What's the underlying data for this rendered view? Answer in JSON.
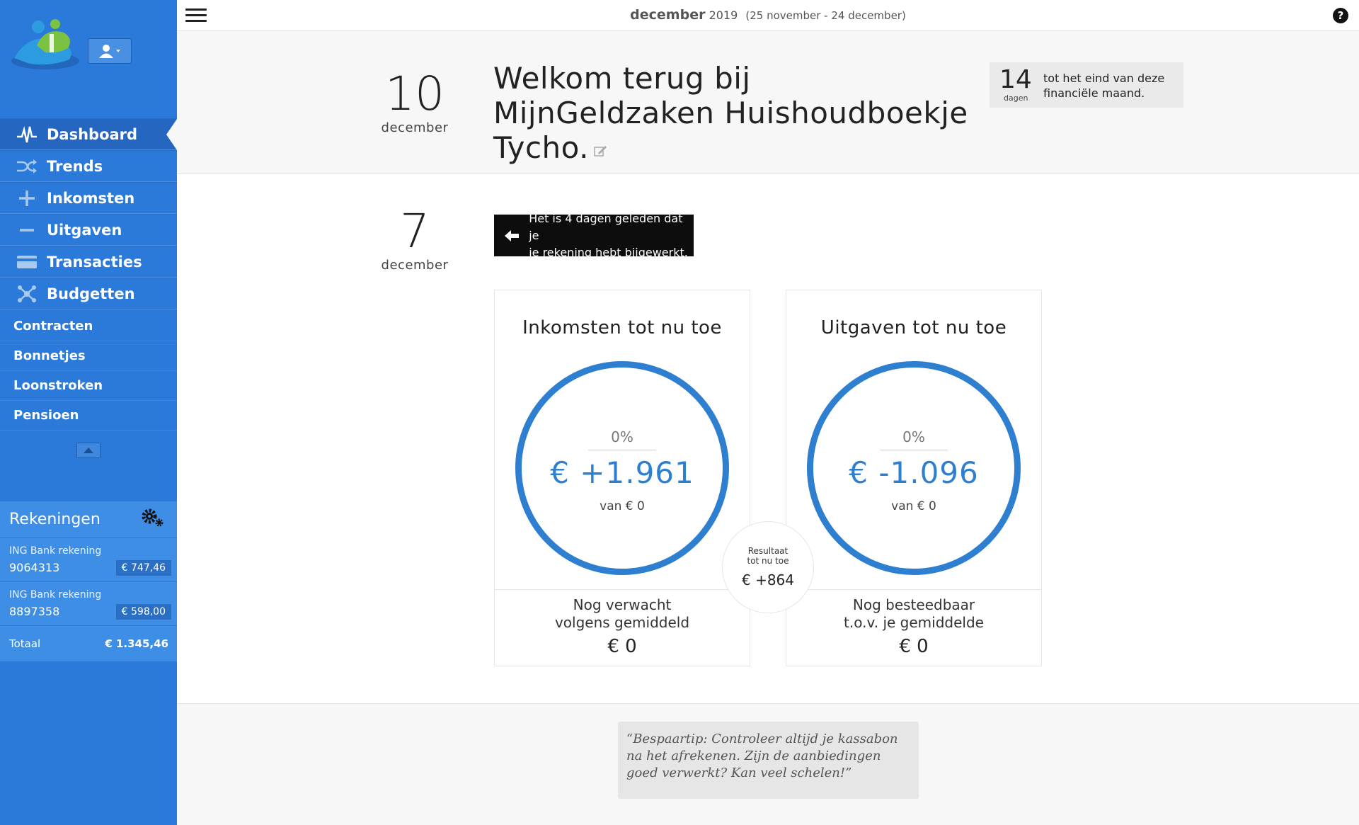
{
  "topbar": {
    "month": "december",
    "year": "2019",
    "range": "(25 november - 24 december)"
  },
  "sidebar": {
    "nav_primary": [
      {
        "label": "Dashboard",
        "icon": "pulse-icon"
      },
      {
        "label": "Trends",
        "icon": "shuffle-icon"
      },
      {
        "label": "Inkomsten",
        "icon": "plus-icon"
      },
      {
        "label": "Uitgaven",
        "icon": "minus-icon"
      },
      {
        "label": "Transacties",
        "icon": "credit-card-icon"
      },
      {
        "label": "Budgetten",
        "icon": "network-icon"
      }
    ],
    "nav_secondary": [
      "Contracten",
      "Bonnetjes",
      "Loonstroken",
      "Pensioen"
    ]
  },
  "accounts": {
    "title": "Rekeningen",
    "items": [
      {
        "name": "ING Bank rekening",
        "number": "9064313",
        "balance": "€ 747,46"
      },
      {
        "name": "ING Bank rekening",
        "number": "8897358",
        "balance": "€ 598,00"
      }
    ],
    "total_label": "Totaal",
    "total_value": "€ 1.345,46"
  },
  "welcome": {
    "day": "10",
    "month": "december",
    "line1": "Welkom terug bij",
    "line2": "MijnGeldzaken Huishoudboekje",
    "line3": "Tycho.",
    "days_left": "14",
    "days_unit": "dagen",
    "days_text_1": "tot het eind van deze",
    "days_text_2": "financiële maand."
  },
  "update": {
    "day": "7",
    "month": "december",
    "line1": "Het is 4 dagen geleden dat je",
    "line2": "je rekening hebt bijgewerkt."
  },
  "income": {
    "title": "Inkomsten tot nu toe",
    "percent": "0%",
    "amount": "€ +1.961",
    "of": "van € 0",
    "foot_line1": "Nog verwacht",
    "foot_line2": "volgens gemiddeld",
    "foot_value": "€ 0"
  },
  "expenses": {
    "title": "Uitgaven tot nu toe",
    "percent": "0%",
    "amount": "€ -1.096",
    "of": "van € 0",
    "foot_line1": "Nog besteedbaar",
    "foot_line2": "t.o.v. je gemiddelde",
    "foot_value": "€ 0"
  },
  "result": {
    "label1": "Resultaat",
    "label2": "tot nu toe",
    "value": "€ +864"
  },
  "tip": {
    "text": "“Bespaartip: Controleer altijd je kassabon na het afrekenen. Zijn de aanbiedingen goed verwerkt? Kan veel schelen!”"
  },
  "colors": {
    "sidebar": "#2b7ad9",
    "accent": "#2f7fd0",
    "accounts_panel": "#3f8ee6"
  }
}
